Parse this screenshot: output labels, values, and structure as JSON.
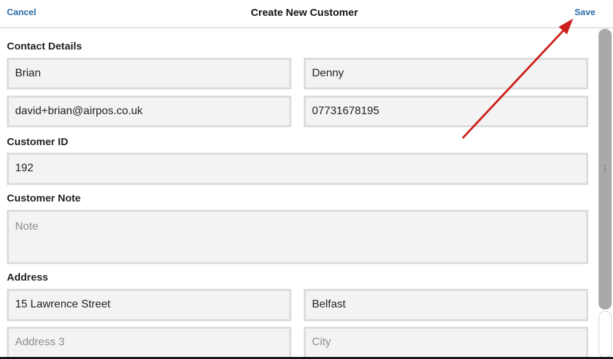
{
  "header": {
    "cancel_label": "Cancel",
    "title": "Create New Customer",
    "save_label": "Save"
  },
  "sections": {
    "contact": {
      "label": "Contact Details",
      "first_name": "Brian",
      "last_name": "Denny",
      "email": "david+brian@airpos.co.uk",
      "phone": "07731678195"
    },
    "customer_id": {
      "label": "Customer ID",
      "value": "192"
    },
    "customer_note": {
      "label": "Customer Note",
      "placeholder": "Note"
    },
    "address": {
      "label": "Address",
      "line1": "15 Lawrence Street",
      "line2": "Belfast",
      "line3_placeholder": "Address 3",
      "city_placeholder": "City"
    }
  },
  "annotation": {
    "arrow_color": "#cc1f1a",
    "points_to": "save-button"
  },
  "colors": {
    "link": "#2a6aa6",
    "field_bg": "#f3f3f3",
    "field_border": "#dcdcdc",
    "scroll_thumb": "#a9a9a9"
  }
}
